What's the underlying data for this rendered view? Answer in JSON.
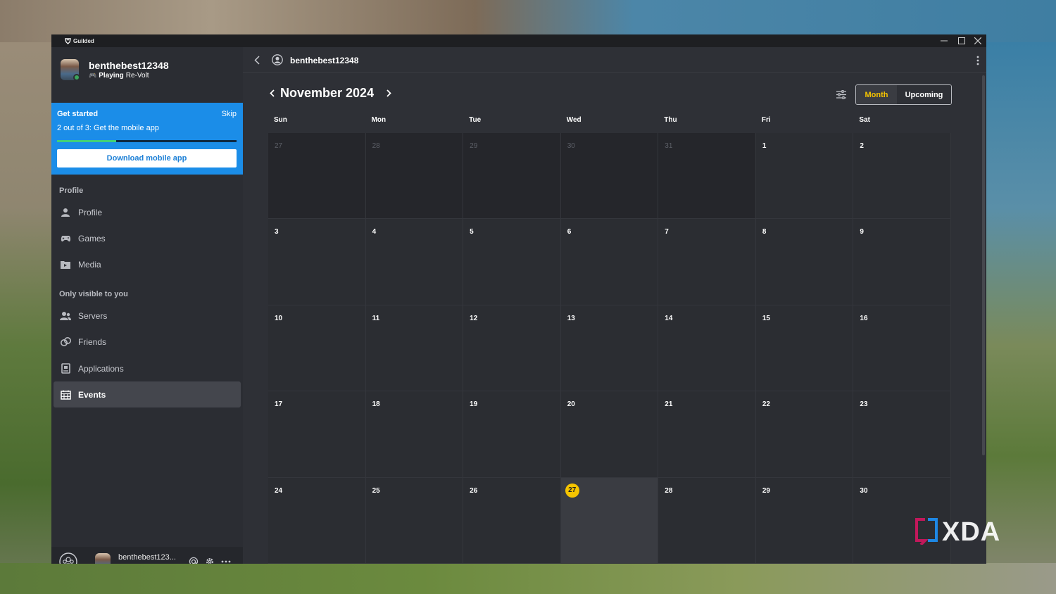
{
  "window": {
    "app_name": "Guilded"
  },
  "user": {
    "name": "benthebest12348",
    "name_short": "benthebest123...",
    "activity": "Playing",
    "game": "Re-Volt"
  },
  "get_started": {
    "title": "Get started",
    "skip": "Skip",
    "subtitle": "2 out of 3: Get the mobile app",
    "progress": 0.33,
    "button": "Download mobile app"
  },
  "sections": {
    "profile": "Profile",
    "private": "Only visible to you"
  },
  "nav": {
    "profile": "Profile",
    "games": "Games",
    "media": "Media",
    "servers": "Servers",
    "friends": "Friends",
    "applications": "Applications",
    "events": "Events"
  },
  "header": {
    "username": "benthebest12348"
  },
  "calendar": {
    "month_title": "November 2024",
    "view_month": "Month",
    "view_upcoming": "Upcoming",
    "days_of_week": [
      "Sun",
      "Mon",
      "Tue",
      "Wed",
      "Thu",
      "Fri",
      "Sat"
    ],
    "weeks": [
      [
        "27",
        "28",
        "29",
        "30",
        "31",
        "1",
        "2"
      ],
      [
        "3",
        "4",
        "5",
        "6",
        "7",
        "8",
        "9"
      ],
      [
        "10",
        "11",
        "12",
        "13",
        "14",
        "15",
        "16"
      ],
      [
        "17",
        "18",
        "19",
        "20",
        "21",
        "22",
        "23"
      ],
      [
        "24",
        "25",
        "26",
        "27",
        "28",
        "29",
        "30"
      ]
    ],
    "today": "27"
  },
  "watermark": {
    "text": "XDA"
  },
  "colors": {
    "accent": "#f5c400",
    "banner": "#1b8de8",
    "online": "#3ba55c"
  }
}
